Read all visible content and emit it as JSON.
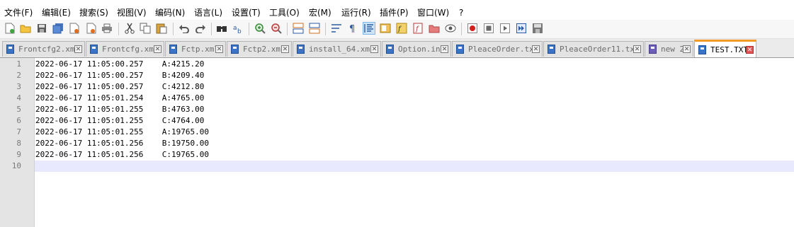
{
  "menu": [
    "文件(F)",
    "编辑(E)",
    "搜索(S)",
    "视图(V)",
    "编码(N)",
    "语言(L)",
    "设置(T)",
    "工具(O)",
    "宏(M)",
    "运行(R)",
    "插件(P)",
    "窗口(W)",
    "?"
  ],
  "toolbar": {
    "icons": [
      "new-file-icon",
      "open-file-icon",
      "save-icon",
      "save-all-icon",
      "close-icon",
      "close-all-icon",
      "print-icon",
      "cut-icon",
      "copy-icon",
      "paste-icon",
      "undo-icon",
      "redo-icon",
      "find-icon",
      "replace-icon",
      "zoom-in-icon",
      "zoom-out-icon",
      "sync-vertical-icon",
      "sync-horizontal-icon",
      "word-wrap-icon",
      "show-all-chars-icon",
      "indent-guide-icon",
      "document-map-icon",
      "function-list-icon",
      "folder-workspace-icon",
      "monitoring-icon",
      "record-macro-icon",
      "stop-record-icon",
      "play-macro-icon",
      "run-multiple-macro-icon",
      "save-macro-icon"
    ]
  },
  "tabs": [
    {
      "label": "Frontcfg2.xml",
      "active": false,
      "icon": "blue"
    },
    {
      "label": "Frontcfg.xml",
      "active": false,
      "icon": "blue"
    },
    {
      "label": "Fctp.xml",
      "active": false,
      "icon": "blue"
    },
    {
      "label": "Fctp2.xml",
      "active": false,
      "icon": "blue"
    },
    {
      "label": "install_64.xml",
      "active": false,
      "icon": "blue"
    },
    {
      "label": "Option.ini",
      "active": false,
      "icon": "blue"
    },
    {
      "label": "PleaceOrder.txt",
      "active": false,
      "icon": "blue"
    },
    {
      "label": "PleaceOrder11.txt",
      "active": false,
      "icon": "blue"
    },
    {
      "label": "new 2",
      "active": false,
      "icon": "purple"
    },
    {
      "label": "TEST.TXT",
      "active": true,
      "icon": "blue"
    }
  ],
  "editor": {
    "line_numbers": [
      "1",
      "2",
      "3",
      "4",
      "5",
      "6",
      "7",
      "8",
      "9",
      "10"
    ],
    "lines": [
      "2022-06-17 11:05:00.257    A:4215.20",
      "2022-06-17 11:05:00.257    B:4209.40",
      "2022-06-17 11:05:00.257    C:4212.80",
      "2022-06-17 11:05:01.254    A:4765.00",
      "2022-06-17 11:05:01.255    B:4763.00",
      "2022-06-17 11:05:01.255    C:4764.00",
      "2022-06-17 11:05:01.255    A:19765.00",
      "2022-06-17 11:05:01.256    B:19750.00",
      "2022-06-17 11:05:01.256    C:19765.00",
      ""
    ]
  }
}
